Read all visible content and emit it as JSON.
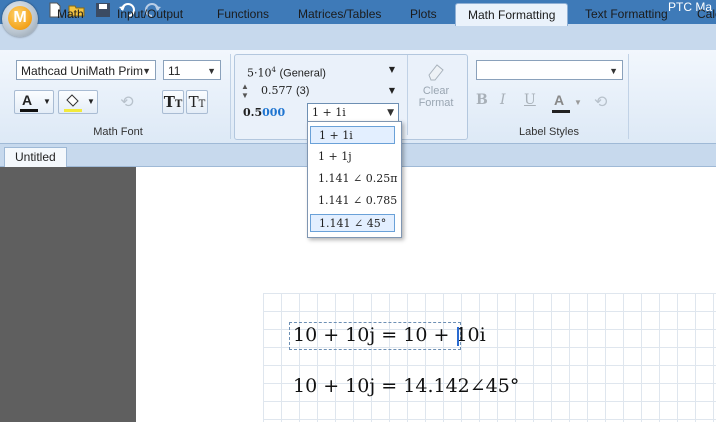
{
  "window": {
    "title": "PTC Ma"
  },
  "app_menu": {
    "logo_letter": "M"
  },
  "quick_access": [
    "new-icon",
    "open-icon",
    "save-icon",
    "undo-icon",
    "redo-icon"
  ],
  "tabs": [
    {
      "label": "Math",
      "active": false
    },
    {
      "label": "Input/Output",
      "active": false
    },
    {
      "label": "Functions",
      "active": false
    },
    {
      "label": "Matrices/Tables",
      "active": false
    },
    {
      "label": "Plots",
      "active": false
    },
    {
      "label": "Math Formatting",
      "active": true
    },
    {
      "label": "Text Formatting",
      "active": false
    },
    {
      "label": "Calc",
      "active": false
    }
  ],
  "math_font": {
    "font_value": "Mathcad UniMath Prim",
    "size_value": "11",
    "group_label": "Math Font",
    "text_color_letter": "A"
  },
  "number_format": {
    "format_value": "5·10",
    "format_exp": "4",
    "format_name": "(General)",
    "precision_value": "0.577",
    "precision_digits": "(3)",
    "preview_main": "0.5",
    "preview_extra": "000",
    "complex_value": "1 + 1i",
    "clear_format_label_1": "Clear",
    "clear_format_label_2": "Format"
  },
  "label_styles": {
    "group_label": "Label Styles",
    "text_color_letter": "A",
    "style_value": ""
  },
  "complex_dropdown": {
    "options": [
      "1 + 1i",
      "1 + 1j",
      "1.141 ∠ 0.25π",
      "1.141 ∠ 0.785",
      "1.141 ∠ 45°"
    ],
    "selected_index": 0
  },
  "document": {
    "tab_label": "Untitled"
  },
  "worksheet": {
    "eq1_lhs": "10 + 10j",
    "eq1_rhs": "10 + 10i",
    "eq2_lhs": "10 + 10j",
    "eq2_rhs": "14.142∠45°"
  },
  "colors": {
    "accent": "#3e7ab8",
    "ribbon": "#dde9f6",
    "preview_highlight": "#1e74d0"
  }
}
